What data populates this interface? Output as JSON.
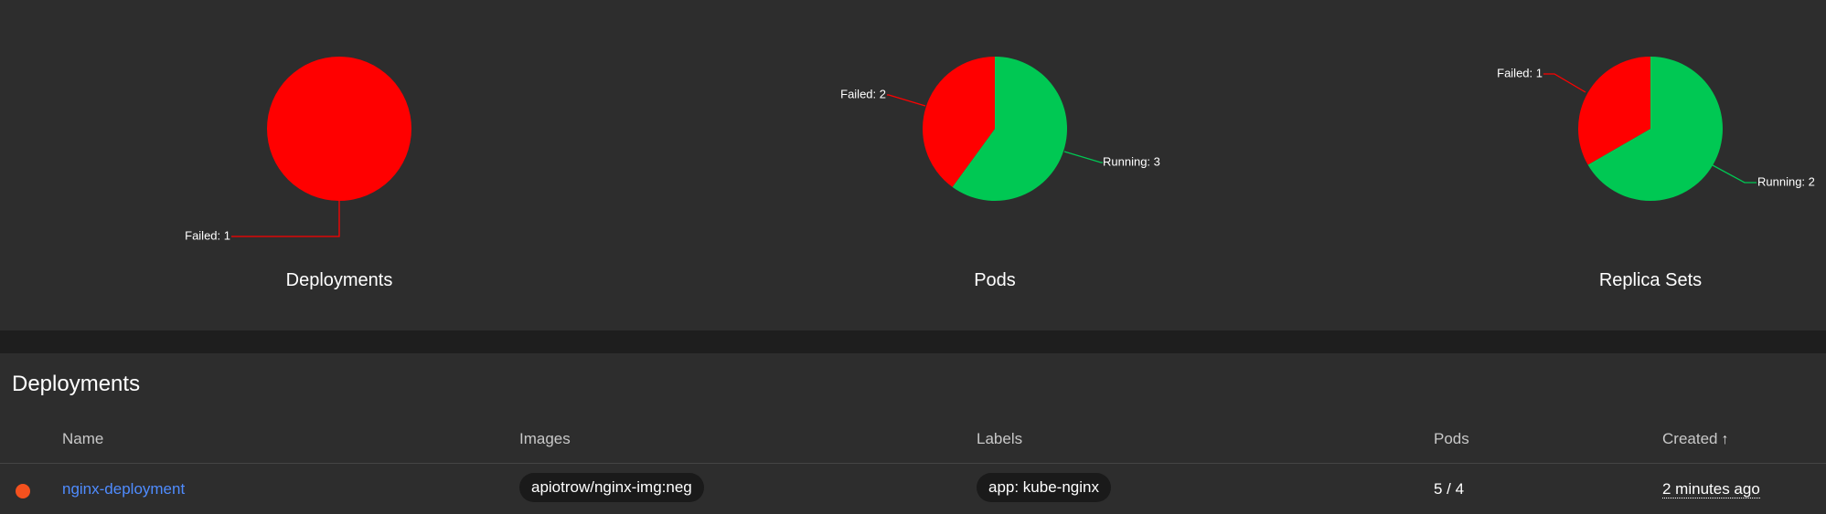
{
  "chart_data": [
    {
      "type": "pie",
      "title": "Deployments",
      "slices": [
        {
          "label": "Failed: 1",
          "value": 1,
          "color": "#ff0000"
        }
      ]
    },
    {
      "type": "pie",
      "title": "Pods",
      "slices": [
        {
          "label": "Running: 3",
          "value": 3,
          "color": "#00c853"
        },
        {
          "label": "Failed: 2",
          "value": 2,
          "color": "#ff0000"
        }
      ]
    },
    {
      "type": "pie",
      "title": "Replica Sets",
      "slices": [
        {
          "label": "Running: 2",
          "value": 2,
          "color": "#00c853"
        },
        {
          "label": "Failed: 1",
          "value": 1,
          "color": "#ff0000"
        }
      ]
    }
  ],
  "table": {
    "title": "Deployments",
    "columns": {
      "name": "Name",
      "images": "Images",
      "labels": "Labels",
      "pods": "Pods",
      "created": "Created"
    },
    "sort_icon": "arrow-up-icon",
    "rows": [
      {
        "status_color": "#f4511e",
        "name": "nginx-deployment",
        "image": "apiotrow/nginx-img:neg",
        "label": "app: kube-nginx",
        "pods": "5 / 4",
        "created": "2 minutes ago"
      }
    ]
  }
}
